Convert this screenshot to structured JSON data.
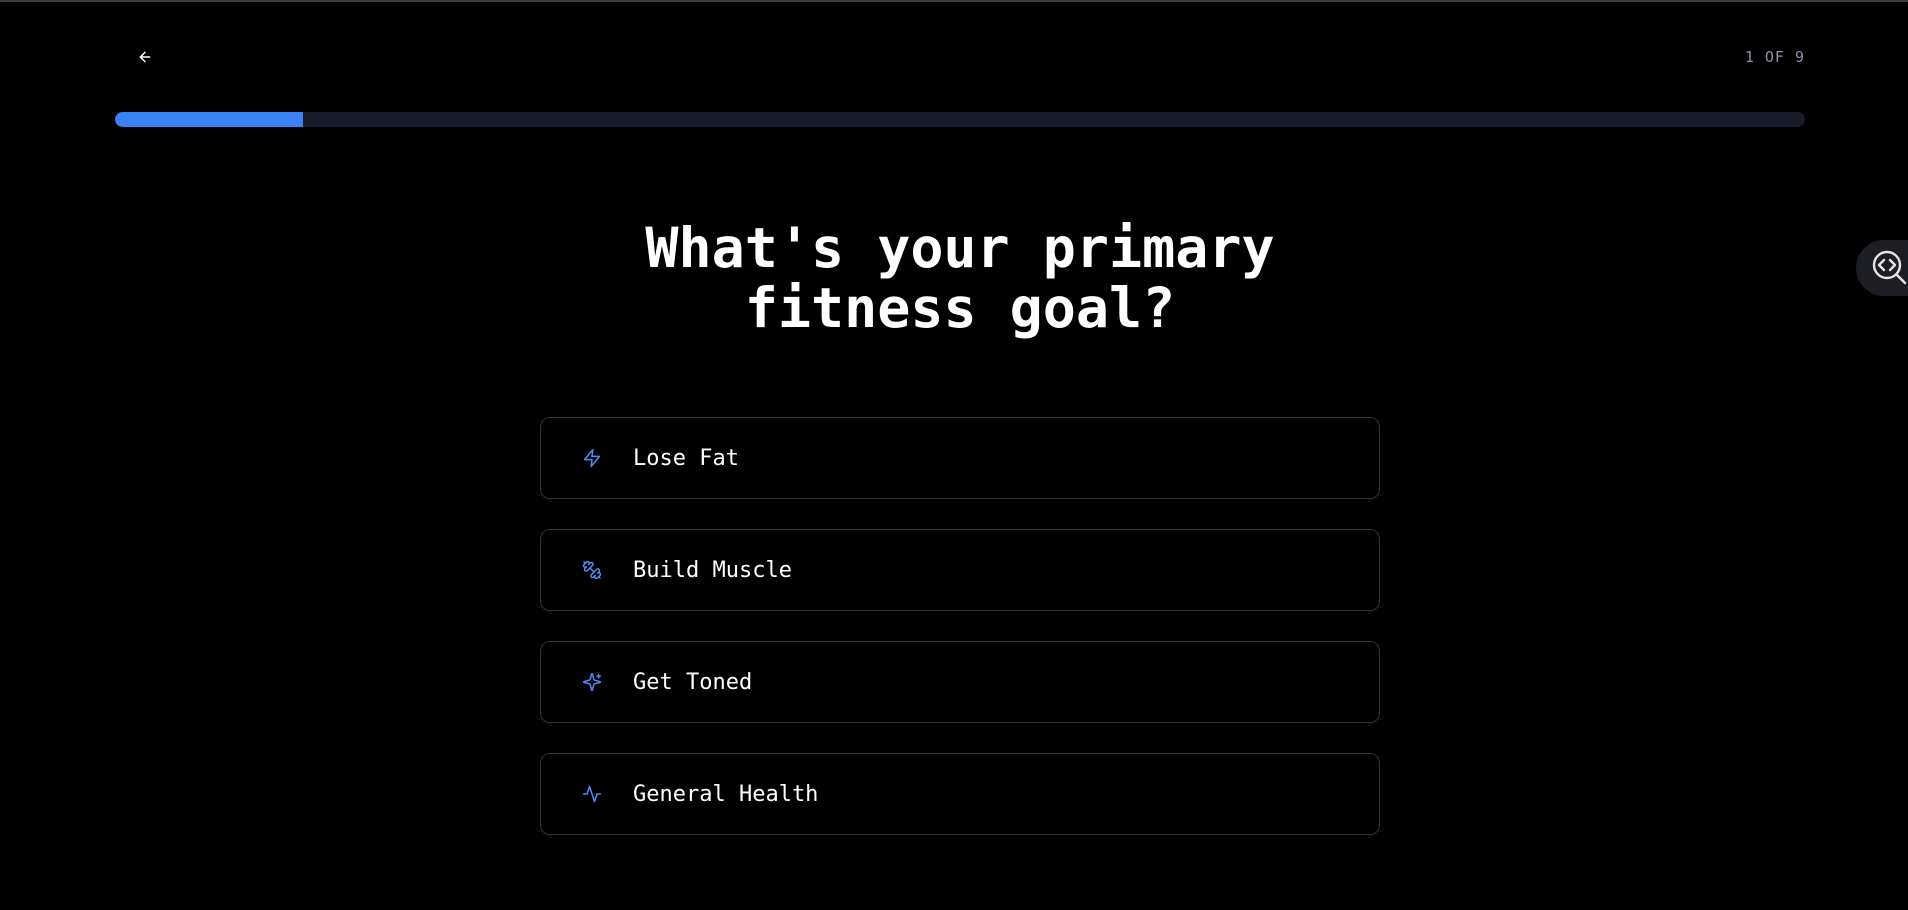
{
  "header": {
    "back_icon": "arrow-left-icon",
    "step_counter": "1 OF 9"
  },
  "progress": {
    "fraction": 0.111,
    "fill_color": "#3b82f6",
    "track_color": "#171c2a"
  },
  "question": {
    "title_line1": "What's your primary",
    "title_line2": "fitness goal?"
  },
  "options": [
    {
      "label": "Lose Fat",
      "icon": "zap-icon"
    },
    {
      "label": "Build Muscle",
      "icon": "dumbbell-icon"
    },
    {
      "label": "Get Toned",
      "icon": "sparkles-icon"
    },
    {
      "label": "General Health",
      "icon": "activity-icon"
    }
  ],
  "side_tool": {
    "icon": "code-search-icon"
  },
  "colors": {
    "background": "#000000",
    "accent": "#3b82f6",
    "border": "#2f3445",
    "muted_text": "#8a92a6"
  }
}
